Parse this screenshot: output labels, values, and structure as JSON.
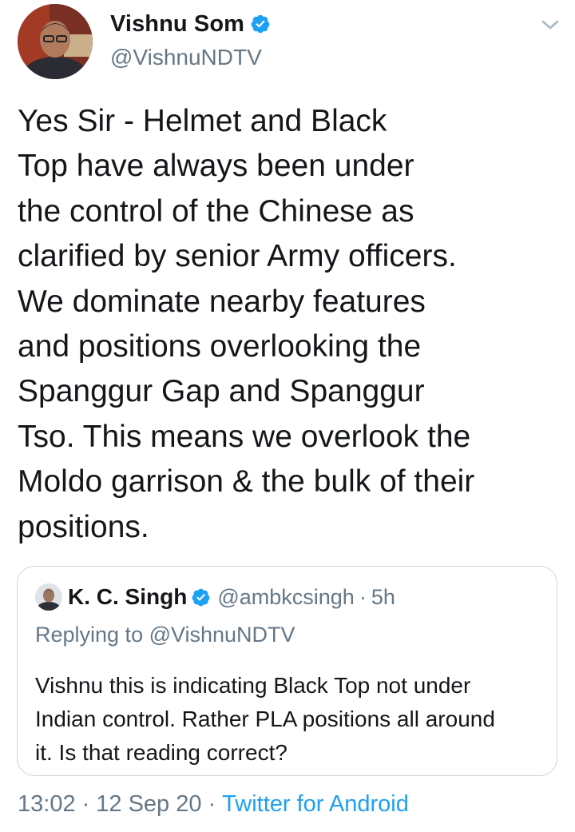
{
  "tweet": {
    "author_name": "Vishnu Som",
    "author_handle": "@VishnuNDTV",
    "verified": true,
    "text_lines": [
      "Yes Sir - Helmet and Black",
      "Top have always been under",
      "the control of the Chinese as",
      "clarified by senior Army officers.",
      "We dominate nearby features",
      "and positions overlooking the",
      "Spanggur Gap and Spanggur",
      "Tso. This means we overlook the",
      "Moldo garrison & the bulk of their",
      "positions."
    ],
    "time": "13:02",
    "date": "12 Sep 20",
    "source": "Twitter for Android",
    "separator": "·"
  },
  "quoted_tweet": {
    "author_name": "K. C. Singh",
    "author_handle": "@ambkcsingh",
    "separator": "·",
    "time_ago": "5h",
    "replying_to": "Replying to @VishnuNDTV",
    "verified": true,
    "text_lines": [
      "Vishnu this is indicating Black Top not under",
      "Indian control. Rather PLA positions all around",
      "it. Is that reading correct?"
    ]
  },
  "colors": {
    "text": "#14171a",
    "secondary": "#657786",
    "link": "#1da1f2",
    "border": "#ccd6dd",
    "verified_badge": "#1da1f2"
  },
  "icons": {
    "verified": "verified-badge-icon",
    "menu": "chevron-down-icon"
  }
}
